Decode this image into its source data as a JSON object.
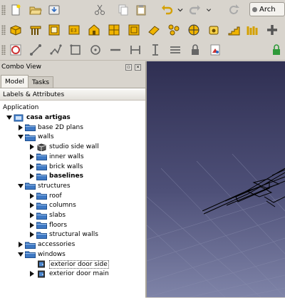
{
  "toolbar": {
    "workbench_label": "Arch",
    "row1_icons": [
      "new-document-icon",
      "open-icon",
      "save-icon",
      "cut-icon",
      "copy-icon",
      "paste-icon",
      "undo-icon",
      "redo-icon",
      "refresh-icon"
    ],
    "row2_icons": [
      "wall-icon",
      "structure-icon",
      "window-icon",
      "section-plane-icon",
      "building-icon",
      "floor-icon",
      "roof-icon",
      "axes-icon",
      "site-icon",
      "component-icon",
      "stairs-icon",
      "space-icon",
      "add-icon"
    ],
    "row3_icons": [
      "snap-lock-icon",
      "snap-line-icon",
      "snap-dimension-icon",
      "snap-rectangle-icon",
      "snap-circle-icon",
      "snap-horizontal-icon",
      "snap-endpoint-icon",
      "snap-vertical-icon",
      "snap-parallel-icon",
      "lock-icon",
      "snap-working-plane-icon",
      "lock-green-icon"
    ]
  },
  "combo_view": {
    "title": "Combo View",
    "tabs": [
      "Model",
      "Tasks"
    ],
    "active_tab": "Model",
    "labels_header": "Labels & Attributes",
    "application_label": "Application"
  },
  "tree": [
    {
      "label": "casa artigas",
      "bold": true
    },
    {
      "label": "base 2D plans"
    },
    {
      "label": "walls"
    },
    {
      "label": "studio side wall"
    },
    {
      "label": "inner walls"
    },
    {
      "label": "brick walls"
    },
    {
      "label": "baselines",
      "bold": true
    },
    {
      "label": "structures"
    },
    {
      "label": "roof"
    },
    {
      "label": "columns"
    },
    {
      "label": "slabs"
    },
    {
      "label": "floors"
    },
    {
      "label": "structural walls"
    },
    {
      "label": "accessories"
    },
    {
      "label": "windows"
    },
    {
      "label": "exterior door side",
      "selected": true
    },
    {
      "label": "exterior door main"
    }
  ],
  "colors": {
    "folder_blue": "#3f79c4",
    "viewport_top": "#2f2f52",
    "viewport_bottom": "#7f84a8",
    "arch_yellow": "#f0b400"
  }
}
